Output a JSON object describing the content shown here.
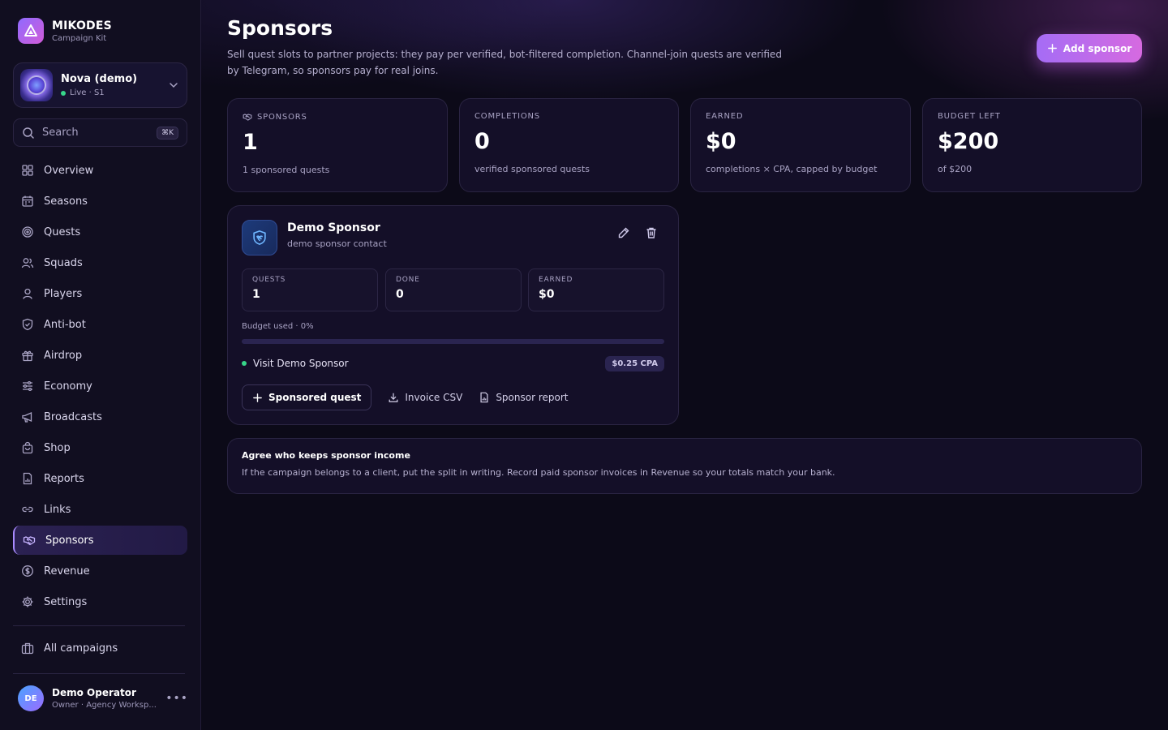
{
  "brand": {
    "name": "MIKODES",
    "tagline": "Campaign Kit"
  },
  "campaign": {
    "name": "Nova (demo)",
    "status": "Live · S1"
  },
  "search": {
    "label": "Search",
    "shortcut": "⌘K"
  },
  "nav": [
    {
      "label": "Overview",
      "icon": "grid-icon"
    },
    {
      "label": "Seasons",
      "icon": "calendar-icon"
    },
    {
      "label": "Quests",
      "icon": "target-icon"
    },
    {
      "label": "Squads",
      "icon": "users-icon"
    },
    {
      "label": "Players",
      "icon": "user-icon"
    },
    {
      "label": "Anti-bot",
      "icon": "shield-check-icon"
    },
    {
      "label": "Airdrop",
      "icon": "gift-icon"
    },
    {
      "label": "Economy",
      "icon": "sliders-icon"
    },
    {
      "label": "Broadcasts",
      "icon": "megaphone-icon"
    },
    {
      "label": "Shop",
      "icon": "bag-icon"
    },
    {
      "label": "Reports",
      "icon": "report-icon"
    },
    {
      "label": "Links",
      "icon": "link-icon"
    },
    {
      "label": "Sponsors",
      "icon": "handshake-icon",
      "active": true
    },
    {
      "label": "Revenue",
      "icon": "dollar-circle-icon"
    },
    {
      "label": "Settings",
      "icon": "gear-icon"
    }
  ],
  "all_campaigns": "All campaigns",
  "user": {
    "initials": "DE",
    "name": "Demo Operator",
    "role": "Owner · Agency Worksp..."
  },
  "page": {
    "title": "Sponsors",
    "description": "Sell quest slots to partner projects: they pay per verified, bot-filtered completion. Channel-join quests are verified by Telegram, so sponsors pay for real joins.",
    "add_label": "Add sponsor"
  },
  "stats": [
    {
      "label": "SPONSORS",
      "value": "1",
      "sub": "1 sponsored quests"
    },
    {
      "label": "COMPLETIONS",
      "value": "0",
      "sub": "verified sponsored quests"
    },
    {
      "label": "EARNED",
      "value": "$0",
      "sub": "completions × CPA, capped by budget"
    },
    {
      "label": "BUDGET LEFT",
      "value": "$200",
      "sub": "of $200"
    }
  ],
  "sponsor": {
    "name": "Demo Sponsor",
    "contact": "demo sponsor contact",
    "metrics": [
      {
        "label": "QUESTS",
        "value": "1"
      },
      {
        "label": "DONE",
        "value": "0"
      },
      {
        "label": "EARNED",
        "value": "$0"
      }
    ],
    "budget_label": "Budget used · 0%",
    "budget_used_percent": 0,
    "quest": {
      "name": "Visit Demo Sponsor",
      "cpa": "$0.25 CPA"
    },
    "actions": {
      "sponsored_quest": "Sponsored quest",
      "invoice": "Invoice CSV",
      "report": "Sponsor report"
    }
  },
  "note": {
    "title": "Agree who keeps sponsor income",
    "text": "If the campaign belongs to a client, put the split in writing. Record paid sponsor invoices in Revenue so your totals match your bank."
  },
  "colors": {
    "accent": "#8f6bff",
    "accent_pink": "#d66ae0",
    "live": "#37d68a"
  }
}
